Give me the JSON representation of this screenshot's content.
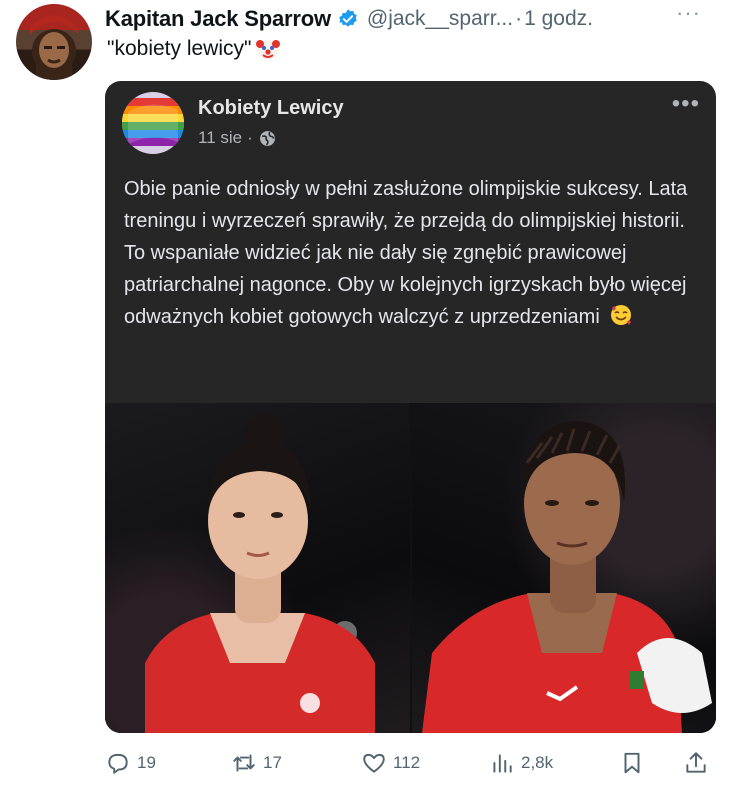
{
  "tweet": {
    "display_name": "Kapitan Jack Sparrow",
    "handle": "@jack__sparr...",
    "separator": "·",
    "time": "1 godz.",
    "more_label": "···",
    "text": "\"kobiety lewicy\"",
    "text_emoji": "clown-face-icon",
    "verified_color": "#1d9bf0"
  },
  "embedded_post": {
    "page_name": "Kobiety Lewicy",
    "date": "11 sie",
    "separator": "·",
    "more_label": "•••",
    "body": "Obie panie odniosły w pełni zasłużone olimpijskie sukcesy. Lata treningu i wyrzeczeń sprawiły, że przejdą do olimpijskiej historii. To wspaniałe widzieć jak nie dały się zgnębić prawicowej patriarchalnej nagonce. Oby w kolejnych igrzyskach było więcej odważnych kobiet gotowych walczyć z uprzedzeniami",
    "body_emoji": "smiling-face-with-hearts-icon",
    "photos": [
      "boxer-left-photo",
      "boxer-right-photo"
    ]
  },
  "actions": {
    "replies": "19",
    "reposts": "17",
    "likes": "112",
    "views": "2,8k"
  }
}
